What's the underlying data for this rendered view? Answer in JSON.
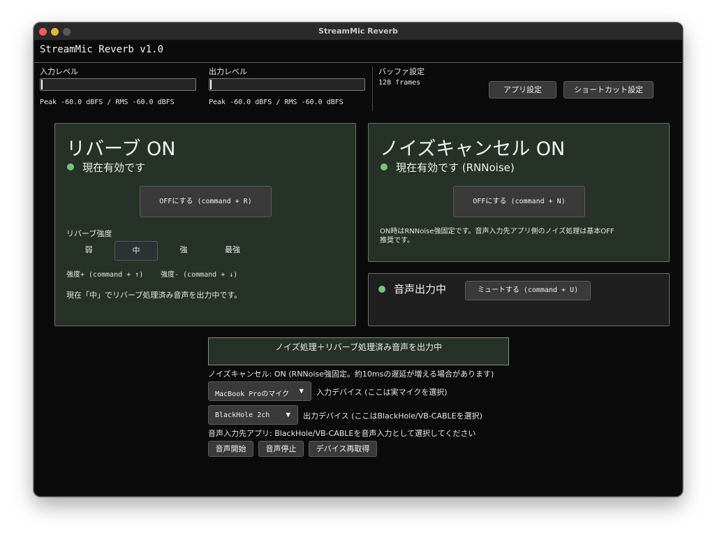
{
  "window": {
    "title": "StreamMic Reverb"
  },
  "app": {
    "title": "StreamMic Reverb v1.0"
  },
  "meters": {
    "input": {
      "label": "入力レベル",
      "value": "Peak -60.0 dBFS / RMS -60.0 dBFS",
      "level": 0.0
    },
    "output": {
      "label": "出力レベル",
      "value": "Peak -60.0 dBFS / RMS -60.0 dBFS",
      "level": 0.0
    }
  },
  "buffer": {
    "label": "バッファ設定",
    "value": "128 frames"
  },
  "header_buttons": {
    "app_settings": "アプリ設定",
    "shortcut_settings": "ショートカット設定"
  },
  "reverb": {
    "heading": "リバーブ ON",
    "status": "現在有効です",
    "toggle_button": "OFFにする (command + R)",
    "strength_label": "リバーブ強度",
    "levels": [
      "弱",
      "中",
      "強",
      "最強"
    ],
    "selected_level": "中",
    "hint_up": "強度+ (command + ↑)",
    "hint_down": "強度- (command + ↓)",
    "message": "現在「中」でリバーブ処理済み音声を出力中です。"
  },
  "noise": {
    "heading": "ノイズキャンセル ON",
    "status": "現在有効です (RNNoise)",
    "toggle_button": "OFFにする (command + N)",
    "note_line1": "ON時はRNNoise強固定です。音声入力先アプリ側のノイズ処理は基本OFF",
    "note_line2": "推奨です。"
  },
  "output_panel": {
    "status": "音声出力中",
    "mute_button": "ミュートする (command + U)"
  },
  "banner": "ノイズ処理＋リバーブ処理済み音声を出力中",
  "noise_info": "ノイズキャンセル: ON (RNNoise強固定。約10msの遅延が増える場合があります)",
  "input_device": {
    "selected": "MacBook Proのマイク",
    "label": "入力デバイス (ここは実マイクを選択)"
  },
  "output_device": {
    "selected": "BlackHole 2ch",
    "label": "出力デバイス (ここはBlackHole/VB-CABLEを選択)"
  },
  "app_hint": "音声入力先アプリ: BlackHole/VB-CABLEを音声入力として選択してください",
  "controls": {
    "start": "音声開始",
    "stop": "音声停止",
    "refresh": "デバイス再取得"
  },
  "colors": {
    "panel_green": "#263228",
    "status_dot": "#79c479",
    "window_bg": "#0b0b0b"
  }
}
